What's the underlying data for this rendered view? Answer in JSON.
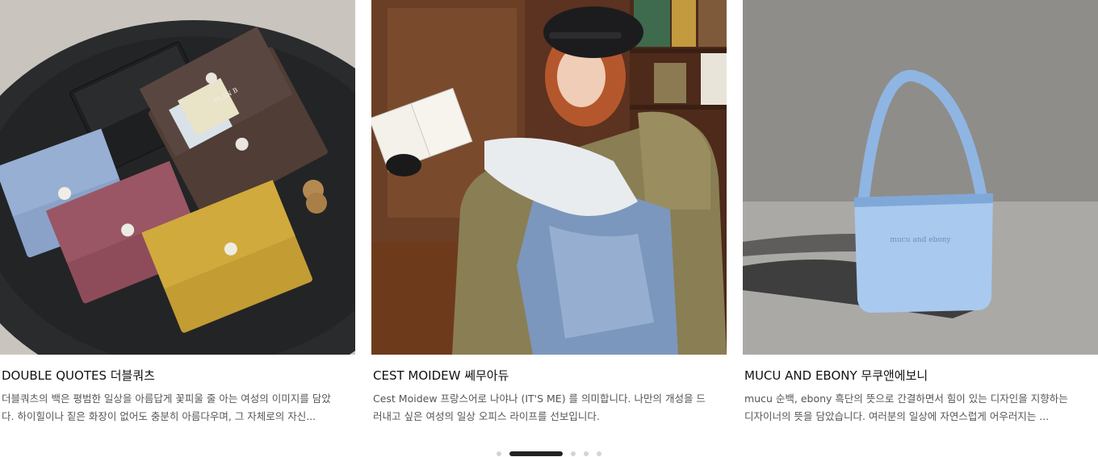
{
  "cards": [
    {
      "title": "DOUBLE QUOTES 더블쿼츠",
      "description": "더블쿼츠의 백은 평범한 일상을 아름답게 꽃피울 줄 아는 여성의 이미지를 담았다. 하이힐이나 짙은 화장이 없어도 충분히 아름다우며, 그 자체로의 자신...",
      "wallet_label": "PLAN B"
    },
    {
      "title": "CEST MOIDEW 쎄무아듀",
      "description": "Cest Moidew 프랑스어로 나야나 (IT'S ME) 를 의미합니다. 나만의 개성을 드러내고 싶은 여성의 일상 오피스 라이프를 선보입니다."
    },
    {
      "title": "MUCU AND EBONY 무쿠앤에보니",
      "description": "mucu 순백, ebony 흑단의 뜻으로 간결하면서 힘이 있는 디자인을 지향하는 디자이너의 뜻을 담았습니다. 여러분의 일상에 자연스럽게 어우러지는 ...",
      "bag_label": "mucu and ebony"
    }
  ],
  "pagination": {
    "total": 5,
    "active_index": 1
  },
  "colors": {
    "dot_active": "#222222",
    "dot_inactive": "#d4d4d4"
  }
}
